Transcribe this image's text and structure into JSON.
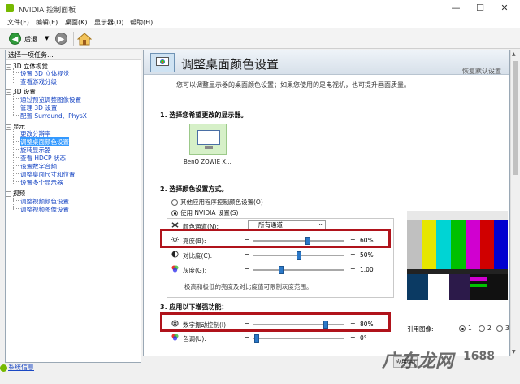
{
  "window": {
    "title": "NVIDIA 控制面板"
  },
  "menu": [
    "文件(F)",
    "编辑(E)",
    "桌面(K)",
    "显示器(D)",
    "帮助(H)"
  ],
  "toolbar": {
    "back_label": "后退"
  },
  "left_panel": {
    "header": "选择一项任务...",
    "groups": [
      {
        "label": "3D 立体视觉",
        "items": [
          "设置 3D 立体视觉",
          "查看游戏分级"
        ]
      },
      {
        "label": "3D 设置",
        "items": [
          "通过预览调整图像设置",
          "管理 3D 设置",
          "配置 Surround、PhysX"
        ]
      },
      {
        "label": "显示",
        "items": [
          "更改分辨率",
          "调整桌面颜色设置",
          "旋转显示器",
          "查看 HDCP 状态",
          "设置数字音频",
          "调整桌面尺寸和位置",
          "设置多个显示器"
        ]
      },
      {
        "label": "视频",
        "items": [
          "调整视频颜色设置",
          "调整视频图像设置"
        ]
      }
    ],
    "selected": "调整桌面颜色设置",
    "system_info": "系统信息"
  },
  "main": {
    "title": "调整桌面颜色设置",
    "restore_default": "恢复默认设置",
    "description": "您可以调整显示器的桌面颜色设置；如果您使用的是电视机，也可提升画面质量。",
    "step1": "1. 选择您希望更改的显示器。",
    "display_name": "BenQ ZOWIE X...",
    "step2": "2. 选择颜色设置方式。",
    "radio_other": "其他应用程序控制颜色设置(O)",
    "radio_nvidia": "使用 NVIDIA 设置(S)",
    "channel_label": "颜色通道(N):",
    "channel_value": "所有通道",
    "sliders": [
      {
        "label": "亮度(B):",
        "value_text": "60%",
        "level": 0.6
      },
      {
        "label": "对比度(C):",
        "value_text": "50%",
        "level": 0.5
      },
      {
        "label": "灰度(G):",
        "value_text": "1.00",
        "level": 0.3
      }
    ],
    "note": "极高和极低的亮度及对比度值可限制灰度范围。",
    "step3": "3. 应用以下增强功能：",
    "vibrance": {
      "label": "数字振动控制(I):",
      "value_text": "80%",
      "level": 0.8
    },
    "hue": {
      "label": "色调(U):",
      "value_text": "0°",
      "level": 0.03
    },
    "ref_label": "引用图像:",
    "ref_options": [
      "1",
      "2",
      "3"
    ],
    "apply_label": "应用(A)"
  },
  "watermark": {
    "text": "广东龙网",
    "badge": "1688"
  },
  "colors": {
    "nvidia_green": "#76b900",
    "highlight_red": "#b0131b",
    "selection_blue": "#3399ff"
  }
}
